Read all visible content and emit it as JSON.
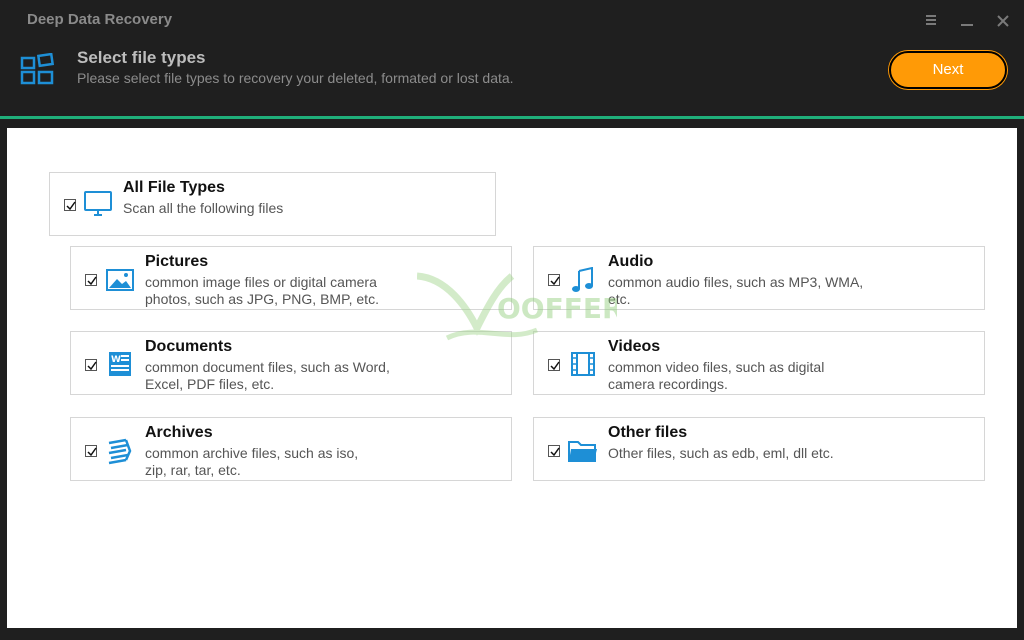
{
  "app": {
    "title": "Deep Data Recovery"
  },
  "header": {
    "title": "Select file types",
    "subtitle": "Please select file types to recovery your deleted, formated or lost data.",
    "next_label": "Next"
  },
  "colors": {
    "accent": "#1fae7a",
    "button": "#ff9a06",
    "icon_blue": "#1e8fd6"
  },
  "all_types": {
    "title": "All File Types",
    "desc": "Scan all the following files",
    "checked": true,
    "icon": "monitor-icon"
  },
  "file_types": [
    {
      "title": "Pictures",
      "desc_1": "common image files or digital camera",
      "desc_2": "photos, such as JPG, PNG, BMP, etc.",
      "checked": true,
      "icon": "picture-icon"
    },
    {
      "title": "Audio",
      "desc_1": "common audio files, such as MP3, WMA,",
      "desc_2": "etc.",
      "checked": true,
      "icon": "music-note-icon"
    },
    {
      "title": "Documents",
      "desc_1": "common document files, such as Word,",
      "desc_2": "Excel, PDF files, etc.",
      "checked": true,
      "icon": "word-document-icon"
    },
    {
      "title": "Videos",
      "desc_1": "common video files, such as digital",
      "desc_2": "camera recordings.",
      "checked": true,
      "icon": "film-strip-icon"
    },
    {
      "title": "Archives",
      "desc_1": "common archive files, such as iso,",
      "desc_2": "zip, rar, tar, etc.",
      "checked": true,
      "icon": "archive-icon"
    },
    {
      "title": "Other files",
      "desc_1": "Other files, such as edb, eml, dll etc.",
      "desc_2": "",
      "checked": true,
      "icon": "folder-icon"
    }
  ],
  "watermark": {
    "text": "OOFFERS"
  }
}
